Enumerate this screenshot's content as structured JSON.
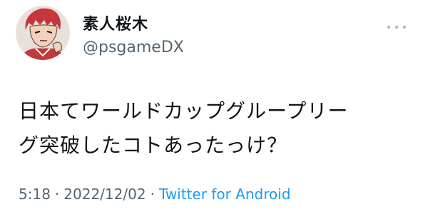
{
  "user": {
    "display_name": "素人桜木",
    "handle": "@psgameDX",
    "avatar_icon": "anime-character-avatar"
  },
  "more_menu_icon": "more-horizontal-icon",
  "tweet": {
    "line1": "日本てワールドカップグループリー",
    "line2": "グ突破したコトあったっけ？"
  },
  "meta": {
    "time": "5:18",
    "separator": "·",
    "date": "2022/12/02",
    "source": "Twitter for Android"
  },
  "colors": {
    "text": "#0f1419",
    "secondary": "#536471",
    "link": "#1d9bf0"
  }
}
